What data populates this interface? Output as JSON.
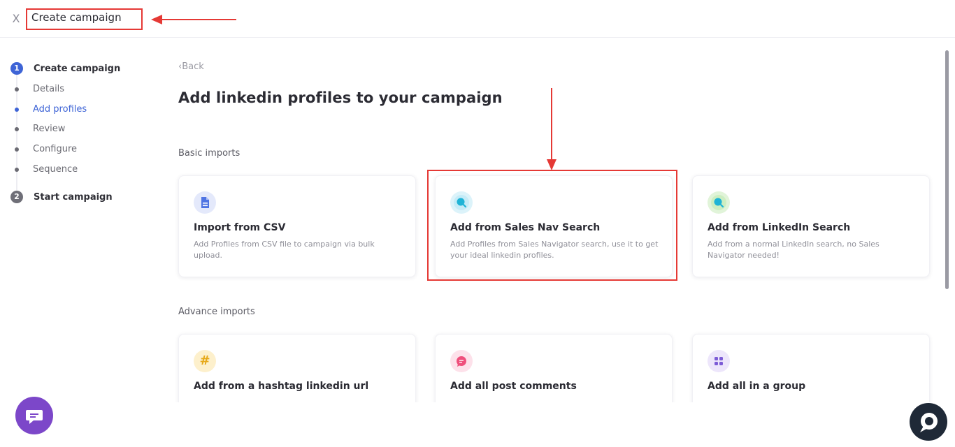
{
  "topbar": {
    "close_icon": "X",
    "title": "Create campaign"
  },
  "sidebar": {
    "steps": [
      {
        "number": "1",
        "title": "Create campaign",
        "substeps": [
          "Details",
          "Add profiles",
          "Review",
          "Configure",
          "Sequence"
        ],
        "current_substep": "Add profiles"
      },
      {
        "number": "2",
        "title": "Start campaign"
      }
    ]
  },
  "main": {
    "back_label": "Back",
    "title": "Add linkedin profiles to your campaign",
    "basic_section": "Basic imports",
    "advance_section": "Advance imports",
    "basic_cards": [
      {
        "icon": "document-icon",
        "title": "Import from CSV",
        "description": "Add Profiles from CSV file to campaign via bulk upload."
      },
      {
        "icon": "sales-nav-search-icon",
        "title": "Add from Sales Nav Search",
        "description": "Add Profiles from Sales Navigator search, use it to get your ideal linkedin profiles."
      },
      {
        "icon": "linkedin-search-icon",
        "title": "Add from LinkedIn Search",
        "description": "Add from a normal LinkedIn search, no Sales Navigator needed!"
      }
    ],
    "advance_cards": [
      {
        "icon": "hashtag-icon",
        "title": "Add from a hashtag linkedin url"
      },
      {
        "icon": "comment-icon",
        "title": "Add all post comments"
      },
      {
        "icon": "group-icon",
        "title": "Add all in a group"
      }
    ]
  },
  "colors": {
    "accent": "#3e64d6",
    "annotation": "#e53935",
    "chat": "#7c47c9"
  }
}
